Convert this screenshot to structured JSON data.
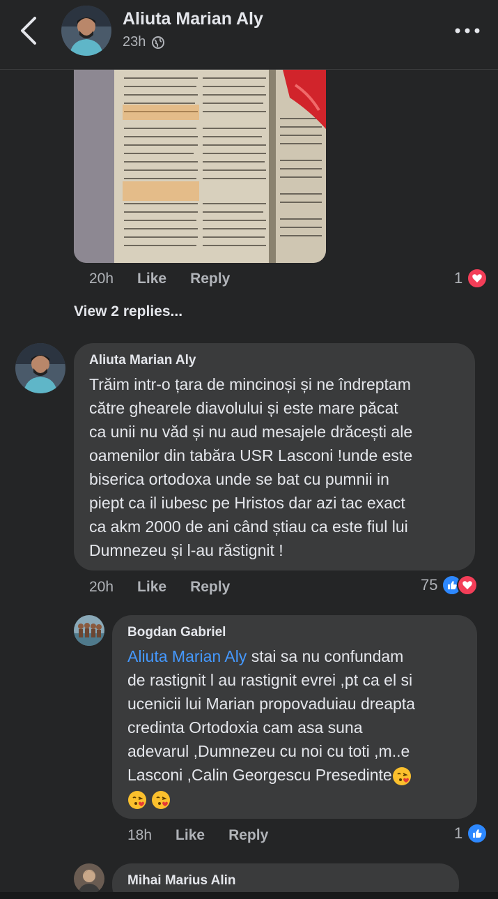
{
  "header": {
    "name": "Aliuta Marian Aly",
    "time": "23h",
    "privacy_icon": "globe-icon"
  },
  "comment0": {
    "time": "20h",
    "like": "Like",
    "reply": "Reply",
    "reaction_count": "1",
    "view_replies": "View 2 replies..."
  },
  "comment1": {
    "author": "Aliuta Marian Aly",
    "text": "Trăim intr-o țara de mincinoși și ne îndreptam\ncătre ghearele diavolului și este  mare păcat\nca unii nu văd și nu aud mesajele drăcești ale\noamenilor din tabăra USR Lasconi !unde este\nbiserica ortodoxa unde se bat cu pumnii in\npiept ca il iubesc pe Hristos dar azi  tac exact\nca akm 2000 de ani când știau ca este fiul lui\nDumnezeu și l-au răstignit !",
    "time": "20h",
    "like": "Like",
    "reply": "Reply",
    "reaction_count": "75"
  },
  "comment2": {
    "author": "Bogdan Gabriel",
    "mention": "Aliuta Marian Aly",
    "text_first": " stai sa nu confundam",
    "text_rest": "de rastignit  l au rastignit evrei ,pt ca el si\nucenicii lui Marian propovaduiau dreapta\ncredinta Ortodoxia  cam asa suna\nadevarul ,Dumnezeu cu noi cu toti ,m..e\nLasconi ,Calin Georgescu Presedinte",
    "emoji": "face-blowing-kiss-icon",
    "time": "18h",
    "like": "Like",
    "reply": "Reply",
    "reaction_count": "1"
  },
  "comment3": {
    "author": "Mihai Marius Alin"
  },
  "colors": {
    "background": "#242526",
    "bubble": "#3a3b3c",
    "mention": "#4599ff",
    "like": "#2d88ff",
    "love": "#f33e58"
  }
}
